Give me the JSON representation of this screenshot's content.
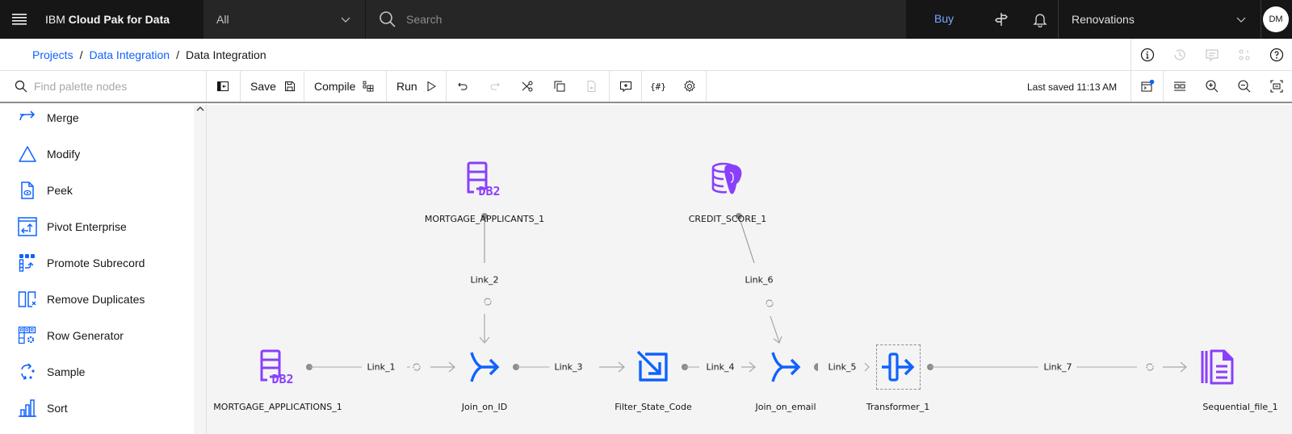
{
  "header": {
    "brand_prefix": "IBM",
    "brand_name": "Cloud Pak for Data",
    "scope_value": "All",
    "search_placeholder": "Search",
    "buy_label": "Buy",
    "account_name": "Renovations",
    "avatar_initials": "DM"
  },
  "breadcrumb": {
    "items": [
      {
        "label": "Projects",
        "link": true
      },
      {
        "label": "Data Integration",
        "link": true
      },
      {
        "label": "Data Integration",
        "link": false
      }
    ],
    "separator": "/"
  },
  "toolbar": {
    "palette_search_placeholder": "Find palette nodes",
    "save_label": "Save",
    "compile_label": "Compile",
    "run_label": "Run",
    "last_saved": "Last saved 11:13 AM"
  },
  "palette": {
    "items": [
      {
        "label": "Merge",
        "icon": "merge-icon"
      },
      {
        "label": "Modify",
        "icon": "modify-icon"
      },
      {
        "label": "Peek",
        "icon": "peek-icon"
      },
      {
        "label": "Pivot Enterprise",
        "icon": "pivot-icon"
      },
      {
        "label": "Promote Subrecord",
        "icon": "promote-subrecord-icon"
      },
      {
        "label": "Remove Duplicates",
        "icon": "remove-duplicates-icon"
      },
      {
        "label": "Row Generator",
        "icon": "row-generator-icon"
      },
      {
        "label": "Sample",
        "icon": "sample-icon"
      },
      {
        "label": "Sort",
        "icon": "sort-icon"
      }
    ]
  },
  "canvas": {
    "nodes": [
      {
        "id": "mortgage_applicants",
        "label": "MORTGAGE_APPLICANTS_1",
        "type": "db2"
      },
      {
        "id": "credit_score",
        "label": "CREDIT_SCORE_1",
        "type": "postgres"
      },
      {
        "id": "mortgage_applications",
        "label": "MORTGAGE_APPLICATIONS_1",
        "type": "db2"
      },
      {
        "id": "join_id",
        "label": "Join_on_ID",
        "type": "join"
      },
      {
        "id": "filter",
        "label": "Filter_State_Code",
        "type": "filter"
      },
      {
        "id": "join_email",
        "label": "Join_on_email",
        "type": "join"
      },
      {
        "id": "transformer",
        "label": "Transformer_1",
        "type": "transformer"
      },
      {
        "id": "seqfile",
        "label": "Sequential_file_1",
        "type": "sequential-file"
      }
    ],
    "links": [
      {
        "label": "Link_1",
        "from": "mortgage_applications",
        "to": "join_id"
      },
      {
        "label": "Link_2",
        "from": "mortgage_applicants",
        "to": "join_id"
      },
      {
        "label": "Link_3",
        "from": "join_id",
        "to": "filter"
      },
      {
        "label": "Link_4",
        "from": "filter",
        "to": "join_email"
      },
      {
        "label": "Link_5",
        "from": "join_email",
        "to": "transformer"
      },
      {
        "label": "Link_6",
        "from": "credit_score",
        "to": "join_email"
      },
      {
        "label": "Link_7",
        "from": "transformer",
        "to": "seqfile"
      }
    ]
  },
  "colors": {
    "brand_blue": "#0f62fe",
    "icon_blue": "#0f62fe",
    "db_purple": "#8a3ffc",
    "buy_link": "#78a9ff",
    "notification_dot": "#0f62fe"
  }
}
